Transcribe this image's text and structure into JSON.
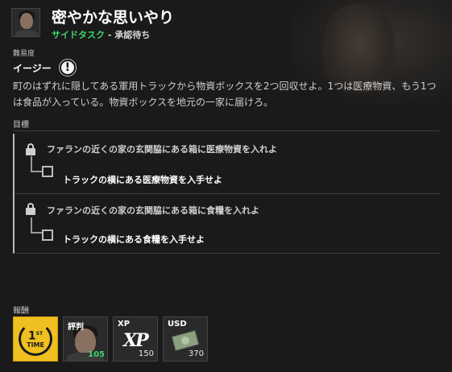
{
  "mission": {
    "title": "密やかな思いやり",
    "type": "サイドタスク",
    "status": " - 承認待ち"
  },
  "difficulty": {
    "label": "難易度",
    "value": "イージー",
    "icon": "exclamation-icon"
  },
  "description": "町のはずれに隠してある軍用トラックから物資ボックスを2つ回収せよ。1つは医療物資、もう1つは食品が入っている。物資ボックスを地元の一家に届けろ。",
  "objectives": {
    "label": "目標",
    "items": [
      {
        "main": "ファランの近くの家の玄関脇にある箱に医療物資を入れよ",
        "sub": "トラックの横にある医療物資を入手せよ",
        "locked": true,
        "checked": false
      },
      {
        "main": "ファランの近くの家の玄関脇にある箱に食糧を入れよ",
        "sub": "トラックの横にある食糧を入手せよ",
        "locked": true,
        "checked": false
      }
    ]
  },
  "rewards": {
    "label": "報酬",
    "items": [
      {
        "name": "first-time",
        "num": "1",
        "suffix": "ST",
        "word": "TIME"
      },
      {
        "name": "reputation",
        "label": "評判",
        "value": "105"
      },
      {
        "name": "xp",
        "label": "XP",
        "logo": "XP",
        "value": "150"
      },
      {
        "name": "usd",
        "label": "USD",
        "value": "370"
      }
    ]
  },
  "colors": {
    "accent_green": "#3fd46a",
    "gold": "#f0c020",
    "background": "#1a1a1a"
  }
}
